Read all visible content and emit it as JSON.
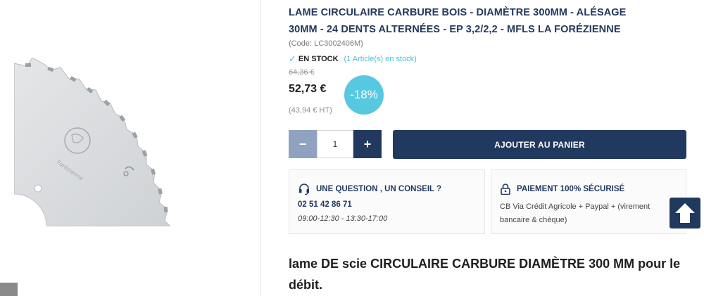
{
  "product": {
    "title": "LAME CIRCULAIRE CARBURE BOIS - DIAMÈTRE 300MM - ALÉSAGE 30MM - 24 DENTS ALTERNÉES - EP 3,2/2,2 - MFLS LA FORÉZIENNE",
    "code": "(Code: LC3002406M)",
    "stock_label": "EN STOCK",
    "stock_qty": "(1 Article(s) en stock)",
    "old_price": "64,36 €",
    "price": "52,73 €",
    "discount": "-18%",
    "price_ht": "(43,94 € HT)",
    "image_brand": "Forézienne"
  },
  "cart": {
    "minus_label": "−",
    "quantity": "1",
    "plus_label": "+",
    "add_label": "AJOUTER AU PANIER"
  },
  "advice": {
    "title": "UNE QUESTION , UN CONSEIL ?",
    "phone": "02 51 42 86 71",
    "hours": "09:00-12:30 - 13:30-17:00",
    "icon": "headset-icon"
  },
  "payment": {
    "title": "PAIEMENT 100% SÉCURISÉ",
    "text": "CB Via Crédit Agricole + Paypal + (virement bancaire & chèque)",
    "icon": "lock-icon"
  },
  "description": {
    "heading": "lame DE scie CIRCULAIRE CARBURE DIAMÈTRE 300 MM pour le débit."
  },
  "colors": {
    "navy": "#21395e",
    "accent": "#56c8e0",
    "muted_button": "#8fa2bf"
  }
}
